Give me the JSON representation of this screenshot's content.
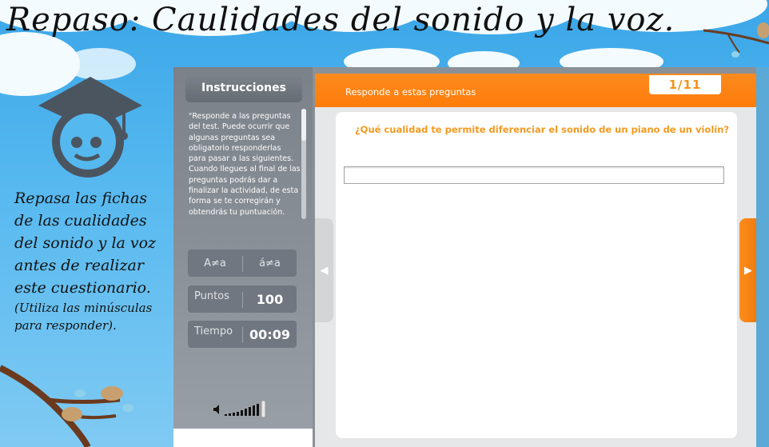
{
  "page": {
    "title": "Repaso: Caulidades del sonido y la voz.",
    "hint_main": "Repasa las fichas de las cualidades del sonido y la voz antes de realizar este cuestionario.",
    "hint_note": "(Utiliza las minúsculas para responder)."
  },
  "panel": {
    "instructions_label": "Instrucciones",
    "instructions_text": "\"Responde a las preguntas del test. Puede ocurrir que algunas preguntas sea obligatorio responderlas para pasar a las siguientes. Cuando llegues al final de las preguntas podrás dar a finalizar la actividad, de esta forma se te corregirán y obtendrás tu puntuación.",
    "case_left": "A≠a",
    "case_right": "á≠a",
    "points_label": "Puntos",
    "points_value": "100",
    "time_label": "Tiempo",
    "time_value": "00:09"
  },
  "quiz": {
    "header": "Responde a estas preguntas",
    "counter": "1/11",
    "question": "¿Qué cualidad  te permite diferenciar el sonido de un piano de un violín?",
    "answer_value": "",
    "prev_icon": "◀",
    "next_icon": "▶"
  },
  "colors": {
    "accent_orange": "#ff7c0a",
    "question_orange": "#f39a1f",
    "panel_gray": "#7b8189",
    "sky_blue": "#3aa6e8"
  }
}
